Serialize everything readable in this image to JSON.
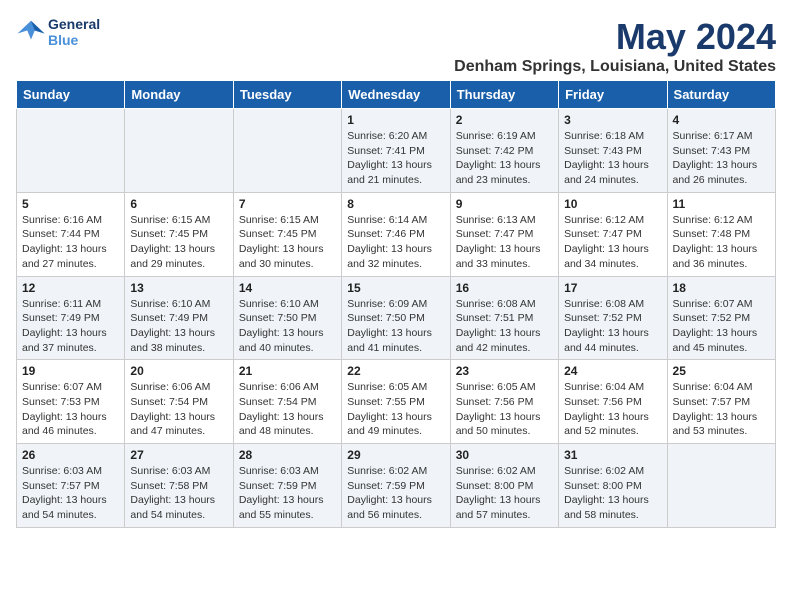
{
  "logo": {
    "text1": "General",
    "text2": "Blue"
  },
  "title": "May 2024",
  "location": "Denham Springs, Louisiana, United States",
  "weekdays": [
    "Sunday",
    "Monday",
    "Tuesday",
    "Wednesday",
    "Thursday",
    "Friday",
    "Saturday"
  ],
  "weeks": [
    [
      {
        "day": "",
        "info": ""
      },
      {
        "day": "",
        "info": ""
      },
      {
        "day": "",
        "info": ""
      },
      {
        "day": "1",
        "info": "Sunrise: 6:20 AM\nSunset: 7:41 PM\nDaylight: 13 hours\nand 21 minutes."
      },
      {
        "day": "2",
        "info": "Sunrise: 6:19 AM\nSunset: 7:42 PM\nDaylight: 13 hours\nand 23 minutes."
      },
      {
        "day": "3",
        "info": "Sunrise: 6:18 AM\nSunset: 7:43 PM\nDaylight: 13 hours\nand 24 minutes."
      },
      {
        "day": "4",
        "info": "Sunrise: 6:17 AM\nSunset: 7:43 PM\nDaylight: 13 hours\nand 26 minutes."
      }
    ],
    [
      {
        "day": "5",
        "info": "Sunrise: 6:16 AM\nSunset: 7:44 PM\nDaylight: 13 hours\nand 27 minutes."
      },
      {
        "day": "6",
        "info": "Sunrise: 6:15 AM\nSunset: 7:45 PM\nDaylight: 13 hours\nand 29 minutes."
      },
      {
        "day": "7",
        "info": "Sunrise: 6:15 AM\nSunset: 7:45 PM\nDaylight: 13 hours\nand 30 minutes."
      },
      {
        "day": "8",
        "info": "Sunrise: 6:14 AM\nSunset: 7:46 PM\nDaylight: 13 hours\nand 32 minutes."
      },
      {
        "day": "9",
        "info": "Sunrise: 6:13 AM\nSunset: 7:47 PM\nDaylight: 13 hours\nand 33 minutes."
      },
      {
        "day": "10",
        "info": "Sunrise: 6:12 AM\nSunset: 7:47 PM\nDaylight: 13 hours\nand 34 minutes."
      },
      {
        "day": "11",
        "info": "Sunrise: 6:12 AM\nSunset: 7:48 PM\nDaylight: 13 hours\nand 36 minutes."
      }
    ],
    [
      {
        "day": "12",
        "info": "Sunrise: 6:11 AM\nSunset: 7:49 PM\nDaylight: 13 hours\nand 37 minutes."
      },
      {
        "day": "13",
        "info": "Sunrise: 6:10 AM\nSunset: 7:49 PM\nDaylight: 13 hours\nand 38 minutes."
      },
      {
        "day": "14",
        "info": "Sunrise: 6:10 AM\nSunset: 7:50 PM\nDaylight: 13 hours\nand 40 minutes."
      },
      {
        "day": "15",
        "info": "Sunrise: 6:09 AM\nSunset: 7:50 PM\nDaylight: 13 hours\nand 41 minutes."
      },
      {
        "day": "16",
        "info": "Sunrise: 6:08 AM\nSunset: 7:51 PM\nDaylight: 13 hours\nand 42 minutes."
      },
      {
        "day": "17",
        "info": "Sunrise: 6:08 AM\nSunset: 7:52 PM\nDaylight: 13 hours\nand 44 minutes."
      },
      {
        "day": "18",
        "info": "Sunrise: 6:07 AM\nSunset: 7:52 PM\nDaylight: 13 hours\nand 45 minutes."
      }
    ],
    [
      {
        "day": "19",
        "info": "Sunrise: 6:07 AM\nSunset: 7:53 PM\nDaylight: 13 hours\nand 46 minutes."
      },
      {
        "day": "20",
        "info": "Sunrise: 6:06 AM\nSunset: 7:54 PM\nDaylight: 13 hours\nand 47 minutes."
      },
      {
        "day": "21",
        "info": "Sunrise: 6:06 AM\nSunset: 7:54 PM\nDaylight: 13 hours\nand 48 minutes."
      },
      {
        "day": "22",
        "info": "Sunrise: 6:05 AM\nSunset: 7:55 PM\nDaylight: 13 hours\nand 49 minutes."
      },
      {
        "day": "23",
        "info": "Sunrise: 6:05 AM\nSunset: 7:56 PM\nDaylight: 13 hours\nand 50 minutes."
      },
      {
        "day": "24",
        "info": "Sunrise: 6:04 AM\nSunset: 7:56 PM\nDaylight: 13 hours\nand 52 minutes."
      },
      {
        "day": "25",
        "info": "Sunrise: 6:04 AM\nSunset: 7:57 PM\nDaylight: 13 hours\nand 53 minutes."
      }
    ],
    [
      {
        "day": "26",
        "info": "Sunrise: 6:03 AM\nSunset: 7:57 PM\nDaylight: 13 hours\nand 54 minutes."
      },
      {
        "day": "27",
        "info": "Sunrise: 6:03 AM\nSunset: 7:58 PM\nDaylight: 13 hours\nand 54 minutes."
      },
      {
        "day": "28",
        "info": "Sunrise: 6:03 AM\nSunset: 7:59 PM\nDaylight: 13 hours\nand 55 minutes."
      },
      {
        "day": "29",
        "info": "Sunrise: 6:02 AM\nSunset: 7:59 PM\nDaylight: 13 hours\nand 56 minutes."
      },
      {
        "day": "30",
        "info": "Sunrise: 6:02 AM\nSunset: 8:00 PM\nDaylight: 13 hours\nand 57 minutes."
      },
      {
        "day": "31",
        "info": "Sunrise: 6:02 AM\nSunset: 8:00 PM\nDaylight: 13 hours\nand 58 minutes."
      },
      {
        "day": "",
        "info": ""
      }
    ]
  ]
}
